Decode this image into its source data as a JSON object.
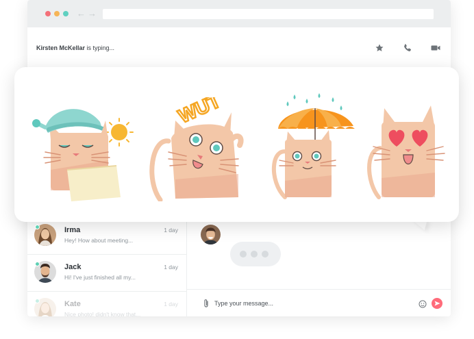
{
  "colors": {
    "dot_red": "#f47079",
    "dot_yellow": "#f6b557",
    "dot_green": "#5fd0c0",
    "accent_send": "#ff6b7a",
    "presence": "#5fd0b4"
  },
  "browser": {
    "back_icon": "←",
    "forward_icon": "→"
  },
  "header": {
    "typing_name": "Kirsten McKellar",
    "typing_suffix": " is typing...",
    "icons": [
      "star-icon",
      "phone-icon",
      "video-camera-icon"
    ]
  },
  "stickers": [
    {
      "name": "sleepy-cat-sticker"
    },
    {
      "name": "wut-cat-sticker",
      "text": "WUT"
    },
    {
      "name": "umbrella-cat-sticker"
    },
    {
      "name": "heart-eyes-cat-sticker"
    }
  ],
  "contacts": [
    {
      "name": "Irma",
      "message": "Hey! How about meeting...",
      "time": "1 day",
      "online": true
    },
    {
      "name": "Jack",
      "message": "Hi! I've just finished all my...",
      "time": "1 day",
      "online": true
    },
    {
      "name": "Kate",
      "message": "Nice photo! didn't know that...",
      "time": "1 day",
      "online": true
    }
  ],
  "composer": {
    "placeholder": "Type your message...",
    "icons": [
      "paperclip-icon",
      "smiley-icon",
      "send-icon"
    ]
  }
}
